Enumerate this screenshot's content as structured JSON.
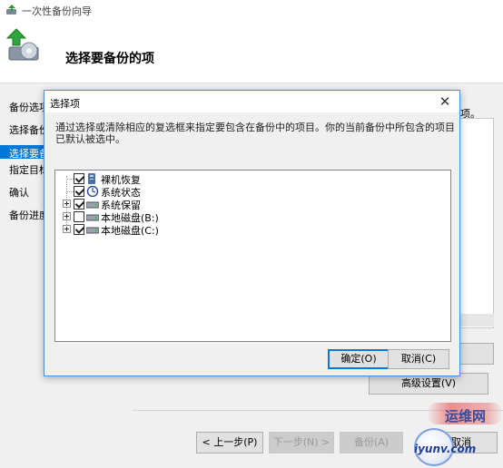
{
  "wizard": {
    "title": "一次性备份向导",
    "heading": "选择要备份的项",
    "nav": [
      {
        "label": "备份选项"
      },
      {
        "label": "选择备份"
      },
      {
        "label": "选择要备"
      },
      {
        "label": "指定目标"
      },
      {
        "label": "确认"
      },
      {
        "label": "备份进度"
      }
    ],
    "right_fragment": "项。",
    "buttons": {
      "advanced": "高级设置(V)",
      "back": "< 上一步(P)",
      "next": "下一步(N) >",
      "backup": "备份(A)",
      "cancel": "取消"
    }
  },
  "dialog": {
    "title": "选择项",
    "close_glyph": "✕",
    "description": "通过选择或清除相应的复选框来指定要包含在备份中的项目。你的当前备份中所包含的项目已默认被选中。",
    "tree": [
      {
        "label": "裸机恢复",
        "checked": true,
        "icon": "bare-metal-icon",
        "expander": false
      },
      {
        "label": "系统状态",
        "checked": true,
        "icon": "system-state-icon",
        "expander": false
      },
      {
        "label": "系统保留",
        "checked": true,
        "icon": "drive-icon",
        "expander": true
      },
      {
        "label": "本地磁盘(B:)",
        "checked": false,
        "icon": "drive-icon",
        "expander": true
      },
      {
        "label": "本地磁盘(C:)",
        "checked": true,
        "icon": "drive-icon",
        "expander": true
      }
    ],
    "buttons": {
      "ok": "确定(O)",
      "cancel": "取消(C)"
    }
  },
  "watermark": {
    "top": "运维网",
    "bottom": "iyunv.com"
  }
}
